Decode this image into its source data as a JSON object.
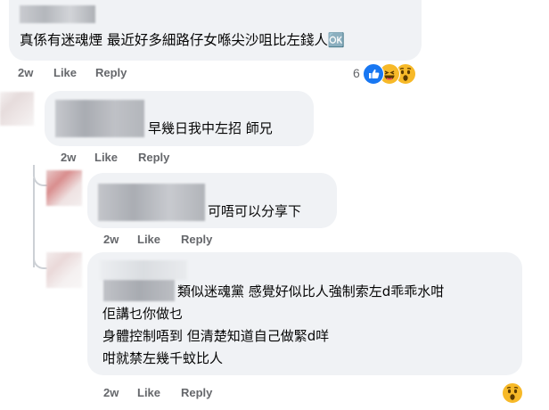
{
  "comments": [
    {
      "text_lines": [
        "真係有迷魂煙 最近好多細路仔女喺尖沙咀比左錢人🆗"
      ],
      "meta": {
        "time": "2w",
        "like": "Like",
        "reply": "Reply"
      },
      "reactions": {
        "count": "6",
        "icons": [
          "like-icon",
          "haha-icon",
          "wow-icon"
        ]
      }
    },
    {
      "text_lines": [
        "早幾日我中左招 師兄"
      ],
      "meta": {
        "time": "2w",
        "like": "Like",
        "reply": "Reply"
      }
    },
    {
      "text_lines": [
        "可唔可以分享下"
      ],
      "meta": {
        "time": "2w",
        "like": "Like",
        "reply": "Reply"
      }
    },
    {
      "text_lines": [
        "類似迷魂黨 感覺好似比人強制索左d乖乖水咁",
        "佢講乜你做乜",
        "身體控制唔到 但清楚知道自己做緊d咩",
        "咁就禁左幾千蚊比人"
      ],
      "meta": {
        "time": "2w",
        "like": "Like",
        "reply": "Reply"
      },
      "reactions": {
        "icons": [
          "wow-icon"
        ]
      }
    }
  ],
  "colors": {
    "bubble": "#f0f2f5",
    "meta": "#65676b",
    "like_blue": "#1877f2",
    "react_yellow": "#f7b928"
  }
}
